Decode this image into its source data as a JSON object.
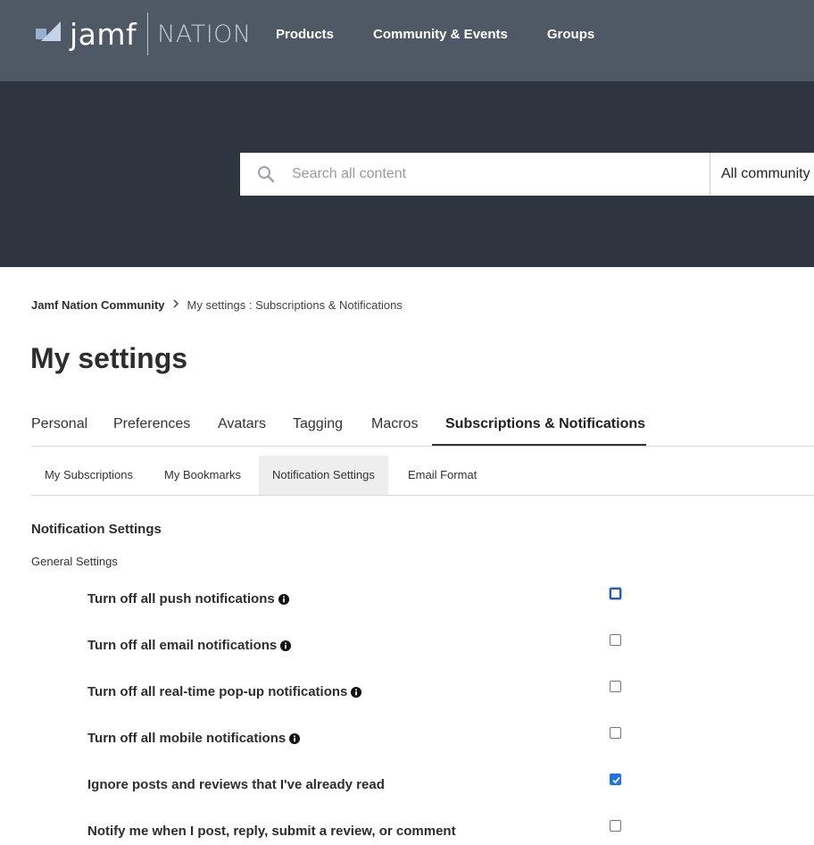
{
  "brand": {
    "name": "jamf",
    "product": "NATION"
  },
  "nav": {
    "items": [
      "Products",
      "Community & Events",
      "Groups"
    ]
  },
  "search": {
    "placeholder": "Search all content",
    "scope": "All community"
  },
  "breadcrumb": {
    "home": "Jamf Nation Community",
    "current": "My settings : Subscriptions & Notifications"
  },
  "page": {
    "title": "My settings"
  },
  "tabs": [
    "Personal",
    "Preferences",
    "Avatars",
    "Tagging",
    "Macros",
    "Subscriptions & Notifications"
  ],
  "subtabs": [
    "My Subscriptions",
    "My Bookmarks",
    "Notification Settings",
    "Email Format"
  ],
  "notifications": {
    "title": "Notification Settings",
    "subtitle": "General Settings",
    "settings": [
      {
        "label": "Turn off all push notifications",
        "info": true,
        "checked": false
      },
      {
        "label": "Turn off all email notifications",
        "info": true,
        "checked": false
      },
      {
        "label": "Turn off all real-time pop-up notifications",
        "info": true,
        "checked": false
      },
      {
        "label": "Turn off all mobile notifications",
        "info": true,
        "checked": false
      },
      {
        "label": "Ignore posts and reviews that I've already read",
        "info": false,
        "checked": true
      },
      {
        "label": "Notify me when I post, reply, submit a review, or comment",
        "info": false,
        "checked": false
      }
    ]
  },
  "colors": {
    "nav_bg": "#4e5965",
    "hero_bg": "#2e353e",
    "checkbox_checked": "#1a73e8"
  }
}
